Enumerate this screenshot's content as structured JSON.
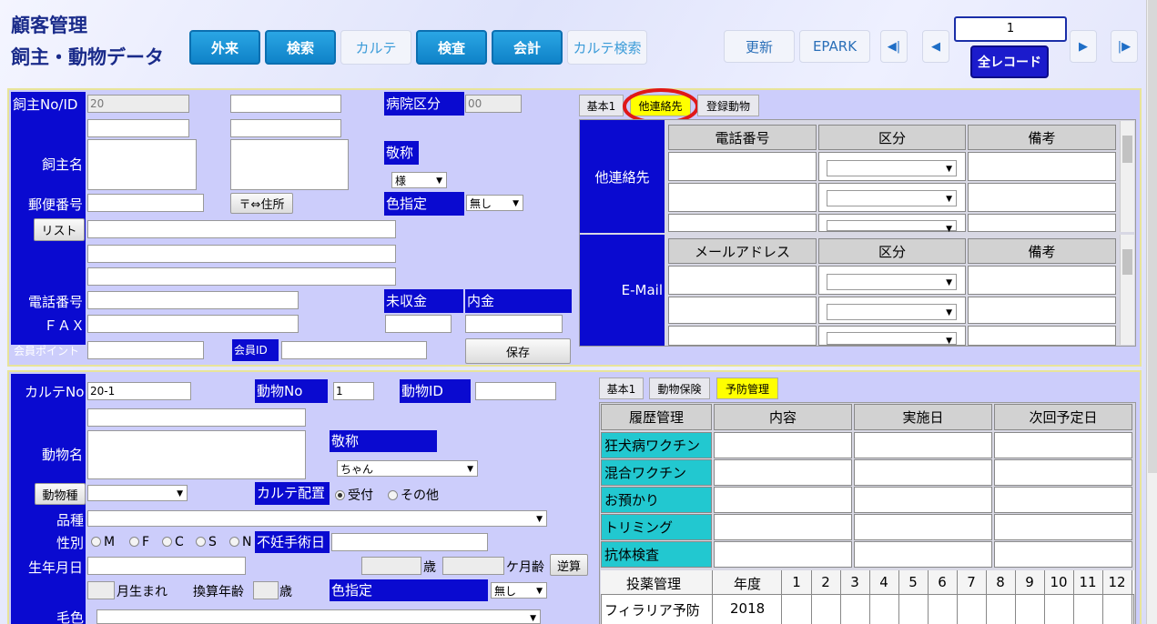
{
  "header": {
    "title_line1": "顧客管理",
    "title_line2": "飼主・動物データ",
    "nav": [
      "外来",
      "検索",
      "カルテ",
      "検査",
      "会計",
      "カルテ検索"
    ],
    "refresh": "更新",
    "epark": "EPARK",
    "record_number": "1",
    "all_records": "全レコード"
  },
  "owner": {
    "owner_no_label": "飼主No/ID",
    "owner_no_value": "20",
    "hospital_div_label": "病院区分",
    "hospital_div_value": "00",
    "owner_name_label": "飼主名",
    "honorific_label": "敬称",
    "honorific_value": "様",
    "postal_label": "郵便番号",
    "postal_btn": "〒⇔住所",
    "color_label": "色指定",
    "color_value": "無し",
    "list_btn": "リスト",
    "phone_label": "電話番号",
    "fax_label": "ＦＡＸ",
    "unpaid_label": "未収金",
    "deposit_label": "内金",
    "points_label": "会員ポイント",
    "member_id_label": "会員ID",
    "save_btn": "保存"
  },
  "contact_tabs": [
    "基本1",
    "他連絡先",
    "登録動物"
  ],
  "contact": {
    "other_label": "他連絡先",
    "phone_header": "電話番号",
    "div_header": "区分",
    "note_header": "備考",
    "email_label": "E-Mail",
    "mail_header": "メールアドレス"
  },
  "animal": {
    "karte_no_label": "カルテNo",
    "karte_no_value": "20-1",
    "animal_no_label": "動物No",
    "animal_no_value": "1",
    "animal_id_label": "動物ID",
    "animal_name_label": "動物名",
    "honorific_label": "敬称",
    "honorific_value": "ちゃん",
    "species_btn": "動物種",
    "karte_place_label": "カルテ配置",
    "karte_place_opt1": "受付",
    "karte_place_opt2": "その他",
    "breed_label": "品種",
    "sex_label": "性別",
    "sex_options": [
      "M",
      "F",
      "C",
      "S",
      "N"
    ],
    "sterile_label": "不妊手術日",
    "birth_label": "生年月日",
    "age_year_unit": "歳",
    "age_month_unit": "ケ月齢",
    "reverse_btn": "逆算",
    "born_month": "月生まれ",
    "conv_age_label": "換算年齢",
    "conv_age_unit": "歳",
    "color_label": "色指定",
    "color_value": "無し",
    "coat_label": "毛色"
  },
  "prevent_tabs": [
    "基本1",
    "動物保険",
    "予防管理"
  ],
  "prevent": {
    "headers": [
      "履歴管理",
      "内容",
      "実施日",
      "次回予定日"
    ],
    "rows": [
      "狂犬病ワクチン",
      "混合ワクチン",
      "お預かり",
      "トリミング",
      "抗体検査"
    ],
    "dose_header": "投薬管理",
    "year_header": "年度",
    "months": [
      "1",
      "2",
      "3",
      "4",
      "5",
      "6",
      "7",
      "8",
      "9",
      "10",
      "11",
      "12"
    ],
    "dose_row_label": "フィラリア予防",
    "dose_row_year": "2018"
  }
}
